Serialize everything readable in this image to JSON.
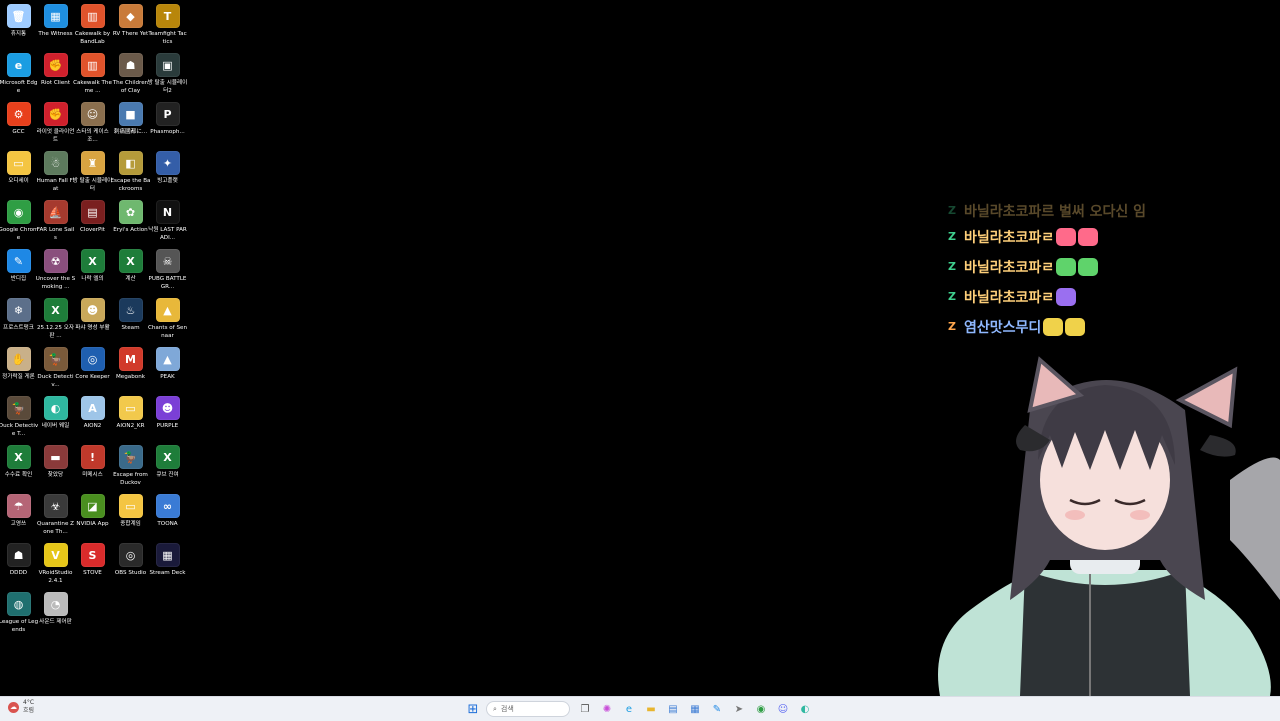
{
  "desktop": {
    "icons": [
      {
        "label": "휴지통",
        "color": "#9ecbff",
        "glyph": "🗑"
      },
      {
        "label": "The Witness",
        "color": "#1f8fe0",
        "glyph": "▦"
      },
      {
        "label": "Cakewalk by BandLab",
        "color": "#e0532b",
        "glyph": "▥"
      },
      {
        "label": "RV There Yet",
        "color": "#c97b3a",
        "glyph": "◆"
      },
      {
        "label": "Teamfight Tactics",
        "color": "#b8860b",
        "glyph": "T"
      },
      {
        "label": "Microsoft Edge",
        "color": "#1b9de2",
        "glyph": "e"
      },
      {
        "label": "Riot Client",
        "color": "#d0202c",
        "glyph": "✊"
      },
      {
        "label": "Cakewalk Theme ...",
        "color": "#e0532b",
        "glyph": "▥"
      },
      {
        "label": "The Children of Clay",
        "color": "#6b5a4a",
        "glyph": "☗"
      },
      {
        "label": "방 탈출 시뮬레이터2",
        "color": "#2a3b3b",
        "glyph": "▣"
      },
      {
        "label": "GCC",
        "color": "#e8401c",
        "glyph": "⚙"
      },
      {
        "label": "라이엇 클라이언트",
        "color": "#d0202c",
        "glyph": "✊"
      },
      {
        "label": "스타의 케이스 조...",
        "color": "#8b6f4e",
        "glyph": "☺"
      },
      {
        "label": "刺痛國都に...",
        "color": "#4a7ab0",
        "glyph": "■"
      },
      {
        "label": "Phasmoph...",
        "color": "#222222",
        "glyph": "P"
      },
      {
        "label": "오디세이",
        "color": "#f4c542",
        "glyph": "▭"
      },
      {
        "label": "Human Fall Flat",
        "color": "#5d7a5d",
        "glyph": "☃"
      },
      {
        "label": "방 탈출 시뮬레이터",
        "color": "#d9a441",
        "glyph": "♜"
      },
      {
        "label": "Escape the Backrooms",
        "color": "#b59b3a",
        "glyph": "◧"
      },
      {
        "label": "빙고플랫",
        "color": "#345ea8",
        "glyph": "✦"
      },
      {
        "label": "Google Chrome",
        "color": "#2f9e44",
        "glyph": "◉"
      },
      {
        "label": "FAR Lone Sails",
        "color": "#a63a2e",
        "glyph": "⛵"
      },
      {
        "label": "CloverPit",
        "color": "#7a1f1f",
        "glyph": "▤"
      },
      {
        "label": "Eryi's Action",
        "color": "#6fb86f",
        "glyph": "✿"
      },
      {
        "label": "낙원 LAST PARADI...",
        "color": "#111111",
        "glyph": "N"
      },
      {
        "label": "반디집",
        "color": "#1e88e5",
        "glyph": "✎"
      },
      {
        "label": "Uncover the Smoking ...",
        "color": "#8a4f7d",
        "glyph": "☢"
      },
      {
        "label": "나락 엘의",
        "color": "#1e7d3a",
        "glyph": "X"
      },
      {
        "label": "계산",
        "color": "#1e7d3a",
        "glyph": "X"
      },
      {
        "label": "PUBG BATTLEGR...",
        "color": "#555555",
        "glyph": "☠"
      },
      {
        "label": "프로스트펑크",
        "color": "#5c6f8a",
        "glyph": "❄"
      },
      {
        "label": "25.12.25 오자판 ...",
        "color": "#1e7d3a",
        "glyph": "X"
      },
      {
        "label": "파샤 명성 부활",
        "color": "#c9a85a",
        "glyph": "☻"
      },
      {
        "label": "Steam",
        "color": "#1b3a5c",
        "glyph": "♨"
      },
      {
        "label": "Chants of Sennaar",
        "color": "#e8b83a",
        "glyph": "▲"
      },
      {
        "label": "정가락질 게론",
        "color": "#c9b089",
        "glyph": "✋"
      },
      {
        "label": "Duck Detectiv...",
        "color": "#7a5a3a",
        "glyph": "🦆"
      },
      {
        "label": "Core Keeper",
        "color": "#1f5fb0",
        "glyph": "◎"
      },
      {
        "label": "Megabonk",
        "color": "#d13a2a",
        "glyph": "M"
      },
      {
        "label": "PEAK",
        "color": "#7fa8d8",
        "glyph": "▲"
      },
      {
        "label": "Duck Detective T...",
        "color": "#5a4a3a",
        "glyph": "🦆"
      },
      {
        "label": "네이버 웨일",
        "color": "#2fb8a0",
        "glyph": "◐"
      },
      {
        "label": "AION2",
        "color": "#9ec5e8",
        "glyph": "A"
      },
      {
        "label": "AION2_KR",
        "color": "#f2c94c",
        "glyph": "▭"
      },
      {
        "label": "PURPLE",
        "color": "#7b3fd6",
        "glyph": "☻"
      },
      {
        "label": "수수료 확인",
        "color": "#1e7d3a",
        "glyph": "X"
      },
      {
        "label": "찾았당",
        "color": "#8a3a3a",
        "glyph": "▬"
      },
      {
        "label": "미메시스",
        "color": "#c0392b",
        "glyph": "!"
      },
      {
        "label": "Escape from Duckov",
        "color": "#3a6a8a",
        "glyph": "🦆"
      },
      {
        "label": "큐브 진여",
        "color": "#1e7d3a",
        "glyph": "X"
      },
      {
        "label": "고영쓰",
        "color": "#b56576",
        "glyph": "☂"
      },
      {
        "label": "Quarantine Zone Th...",
        "color": "#3a3a3a",
        "glyph": "☣"
      },
      {
        "label": "NVIDIA App",
        "color": "#4a8f1f",
        "glyph": "◪"
      },
      {
        "label": "종합계임",
        "color": "#f4c542",
        "glyph": "▭"
      },
      {
        "label": "TOONA",
        "color": "#3a7bd5",
        "glyph": "∞"
      },
      {
        "label": "DDDD",
        "color": "#222222",
        "glyph": "☗"
      },
      {
        "label": "VRoidStudio 2.4.1",
        "color": "#e6c619",
        "glyph": "V"
      },
      {
        "label": "STOVE",
        "color": "#d92b2b",
        "glyph": "S"
      },
      {
        "label": "OBS Studio",
        "color": "#2a2a2a",
        "glyph": "◎"
      },
      {
        "label": "Stream Deck",
        "color": "#1a1a3a",
        "glyph": "▦"
      },
      {
        "label": "League of Legends",
        "color": "#1f6f6f",
        "glyph": "◍"
      },
      {
        "label": "사운드 제어판",
        "color": "#bbbbbb",
        "glyph": "◔"
      }
    ]
  },
  "chat": {
    "lines": [
      {
        "name": "바닐라초코파르 벌써 오다신 임",
        "badge": "Z",
        "faded": true,
        "emotes": []
      },
      {
        "name": "바닐라초코파ㄹ",
        "badge": "Z",
        "faded": false,
        "emotes": [
          "#ff6a8a",
          "#ff6a8a"
        ]
      },
      {
        "name": "바닐라초코파ㄹ",
        "badge": "Z",
        "faded": false,
        "emotes": [
          "#5fd36b",
          "#5fd36b"
        ]
      },
      {
        "name": "바닐라초코파ㄹ",
        "badge": "Z",
        "faded": false,
        "emotes": [
          "#9a6ff0"
        ]
      },
      {
        "name": "염산맛스무디",
        "badge": "Z",
        "faded": false,
        "emotes": [
          "#f0d24a",
          "#f0d24a"
        ],
        "blue": true
      }
    ]
  },
  "avatar": {
    "label": "VTuber avatar"
  },
  "taskbar": {
    "weather_temp": "4°C",
    "weather_desc": "흐림",
    "search_placeholder": "검색",
    "start_glyph": "⊞",
    "apps": [
      {
        "name": "task-view",
        "glyph": "❐",
        "color": "#555"
      },
      {
        "name": "copilot",
        "glyph": "✺",
        "color": "#c84dd8"
      },
      {
        "name": "edge",
        "glyph": "e",
        "color": "#1b9de2"
      },
      {
        "name": "file-explorer",
        "glyph": "▬",
        "color": "#e8b52e"
      },
      {
        "name": "notepad",
        "glyph": "▤",
        "color": "#3b7bd4"
      },
      {
        "name": "calculator",
        "glyph": "▦",
        "color": "#3b7bd4"
      },
      {
        "name": "bandizip",
        "glyph": "✎",
        "color": "#1e88e5"
      },
      {
        "name": "app-arrow",
        "glyph": "➤",
        "color": "#777"
      },
      {
        "name": "chrome",
        "glyph": "◉",
        "color": "#2f9e44"
      },
      {
        "name": "discord",
        "glyph": "☺",
        "color": "#5865f2"
      },
      {
        "name": "whale",
        "glyph": "◐",
        "color": "#2fb8a0"
      }
    ]
  }
}
